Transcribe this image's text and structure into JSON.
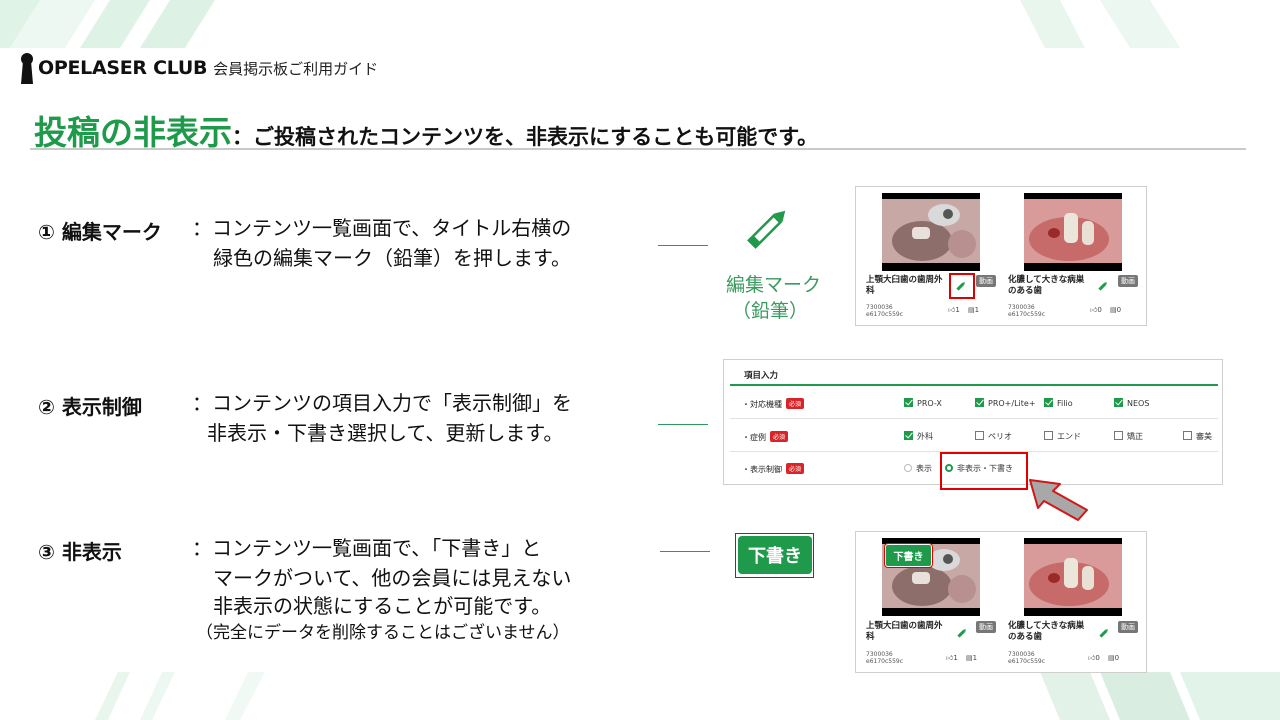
{
  "header": {
    "brand": "OPELASER CLUB",
    "guide_title": "会員掲示板ご利用ガイド"
  },
  "page": {
    "title_main": "投稿の非表示",
    "title_sub": "：ご投稿されたコンテンツを、非表示にすることも可能です。"
  },
  "steps": [
    {
      "label": "① 編集マーク",
      "desc_lines": [
        "：コンテンツ一覧画面で、タイトル右横の",
        "緑色の編集マーク（鉛筆）を押します。"
      ]
    },
    {
      "label": "② 表示制御",
      "desc_lines": [
        "：コンテンツの項目入力で「表示制御」を",
        "非表示・下書き選択して、更新します。"
      ]
    },
    {
      "label": "③ 非表示",
      "desc_lines": [
        "：コンテンツ一覧画面で、「下書き」と",
        "マークがついて、他の会員には見えない",
        "非表示の状態にすることが可能です。",
        "（完全にデータを削除することはございません）"
      ]
    }
  ],
  "pencil_caption": [
    "編集マーク",
    "（鉛筆）"
  ],
  "cards": [
    {
      "title_lines": [
        "上顎大臼歯の歯周外",
        "科"
      ],
      "tag": "動画",
      "meta_lines": [
        "7300036",
        "e6170c559c"
      ],
      "likes": "1",
      "comments": "1"
    },
    {
      "title_lines": [
        "化膿して大きな病巣",
        "のある歯"
      ],
      "tag": "動画",
      "meta_lines": [
        "7300036",
        "e6170c559c"
      ],
      "likes": "0",
      "comments": "0"
    }
  ],
  "form": {
    "section_title": "項目入力",
    "required_label": "必須",
    "rows": [
      {
        "label": "・対応機種",
        "options": [
          {
            "text": "PRO-X",
            "checked": true
          },
          {
            "text": "PRO+/Lite+",
            "checked": true
          },
          {
            "text": "Filio",
            "checked": true
          },
          {
            "text": "NEOS",
            "checked": true
          }
        ]
      },
      {
        "label": "・症例",
        "options": [
          {
            "text": "外科",
            "checked": true
          },
          {
            "text": "ペリオ",
            "checked": false
          },
          {
            "text": "エンド",
            "checked": false
          },
          {
            "text": "矯正",
            "checked": false
          },
          {
            "text": "審美",
            "checked": false
          }
        ]
      },
      {
        "label": "・表示制御",
        "options": [
          {
            "text": "表示",
            "checked": false
          },
          {
            "text": "非表示・下書き",
            "checked": true
          }
        ]
      }
    ]
  },
  "draft_label": "下書き",
  "colors": {
    "brand_green": "#1e9a4a",
    "highlight_red": "#e00000",
    "required_red": "#d9242a"
  }
}
